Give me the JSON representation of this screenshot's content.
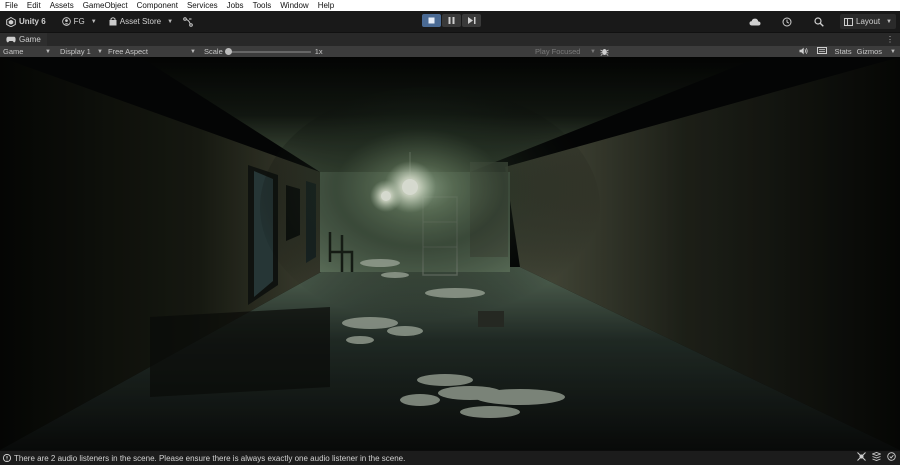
{
  "menu": [
    "File",
    "Edit",
    "Assets",
    "GameObject",
    "Component",
    "Services",
    "Jobs",
    "Tools",
    "Window",
    "Help"
  ],
  "toolbar": {
    "unity_label": "Unity 6",
    "account_label": "FG",
    "asset_store_label": "Asset Store",
    "layout_label": "Layout"
  },
  "tab": {
    "label": "Game"
  },
  "gamebar": {
    "view_select": "Game",
    "display_select": "Display 1",
    "aspect_select": "Free Aspect",
    "scale_label": "Scale",
    "scale_value": "1x",
    "scale_level": 0.0,
    "play_mode_select": "Play Focused",
    "stats_label": "Stats",
    "gizmos_label": "Gizmos"
  },
  "status": {
    "message": "There are 2 audio listeners in the scene. Please ensure there is always exactly one audio listener in the scene."
  },
  "colors": {
    "menubar_bg": "#ffffff",
    "editor_bg": "#191919",
    "play_active": "#4a6a94",
    "scene_fog": "#a8c2a0",
    "light": "#fbfff2"
  }
}
